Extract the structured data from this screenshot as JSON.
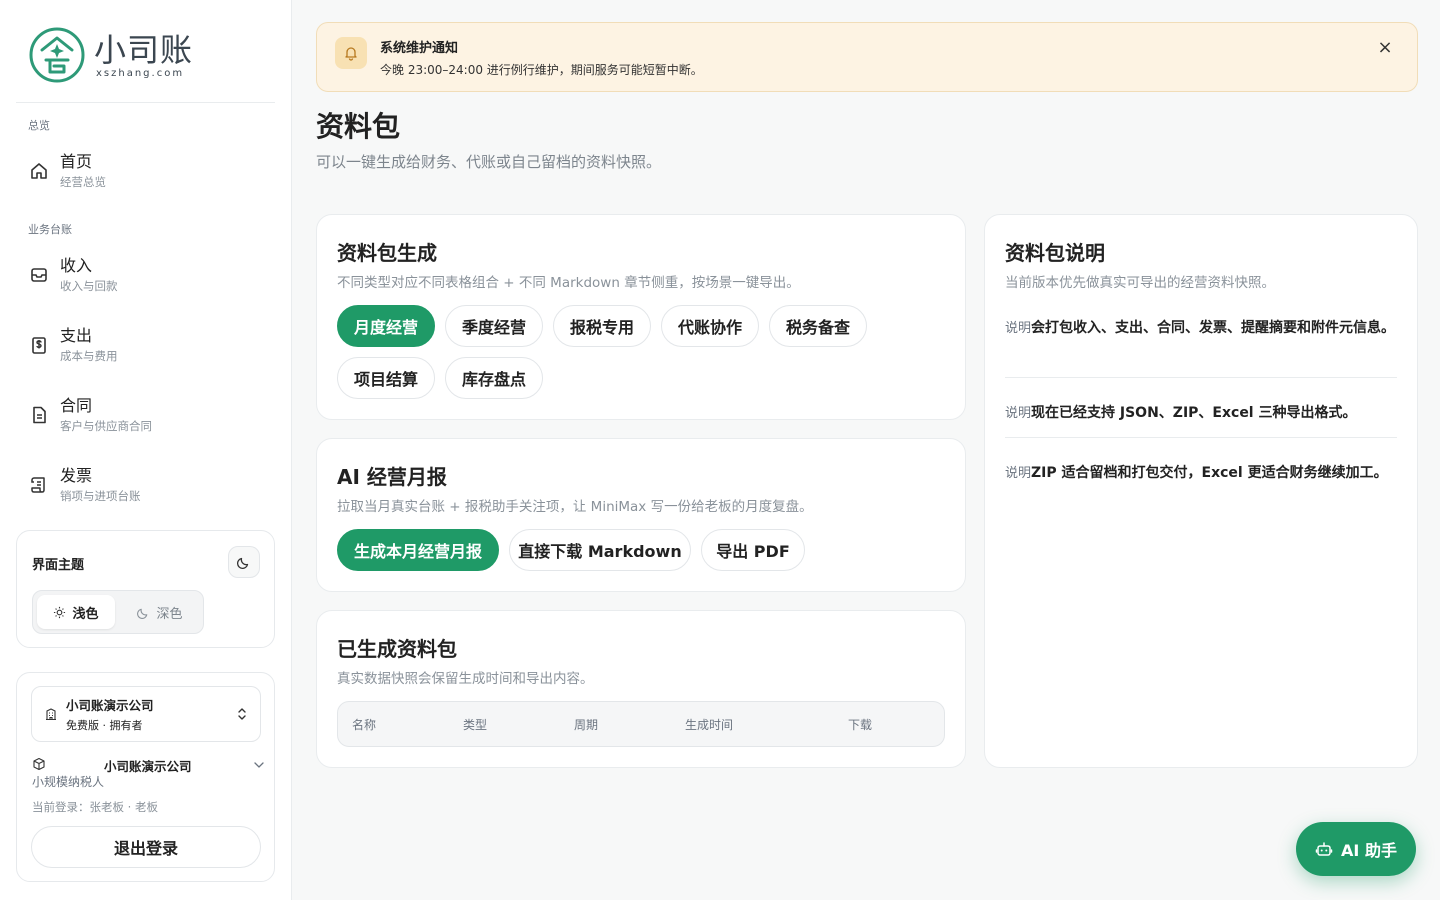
{
  "brand": {
    "name": "小司账",
    "domain": "xszhang.com",
    "color": "#1f9a67"
  },
  "sidebar": {
    "sections": [
      {
        "label": "总览"
      },
      {
        "label": "业务台账"
      }
    ],
    "items": [
      {
        "title": "首页",
        "sub": "经营总览",
        "icon": "home-icon"
      },
      {
        "title": "收入",
        "sub": "收入与回款",
        "icon": "inbox-icon"
      },
      {
        "title": "支出",
        "sub": "成本与费用",
        "icon": "receipt-dollar-icon"
      },
      {
        "title": "合同",
        "sub": "客户与供应商合同",
        "icon": "document-icon"
      },
      {
        "title": "发票",
        "sub": "销项与进项台账",
        "icon": "scroll-icon"
      }
    ],
    "theme": {
      "title": "界面主题",
      "light": "浅色",
      "dark": "深色",
      "selected": "浅色"
    },
    "account": {
      "company_name": "小司账演示公司",
      "plan": "免费版 · 拥有者",
      "company_row_name": "小司账演示公司",
      "taxpayer_type": "小规模纳税人",
      "login_info": "当前登录：张老板 · 老板",
      "logout_label": "退出登录"
    }
  },
  "notice": {
    "title": "系统维护通知",
    "text": "今晚 23:00–24:00 进行例行维护，期间服务可能短暂中断。",
    "close": "×"
  },
  "page": {
    "title": "资料包",
    "subtitle": "可以一键生成给财务、代账或自己留档的资料快照。"
  },
  "generate_card": {
    "title": "资料包生成",
    "subtitle": "不同类型对应不同表格组合 + 不同 Markdown 章节侧重，按场景一键导出。",
    "types": [
      "月度经营",
      "季度经营",
      "报税专用",
      "代账协作",
      "税务备查",
      "项目结算",
      "库存盘点"
    ],
    "selected": "月度经营"
  },
  "ai_report_card": {
    "title": "AI 经营月报",
    "subtitle": "拉取当月真实台账 + 报税助手关注项，让 MiniMax 写一份给老板的月度复盘。",
    "actions": [
      "生成本月经营月报",
      "直接下载 Markdown",
      "导出 PDF"
    ]
  },
  "history_card": {
    "title": "已生成资料包",
    "subtitle": "真实数据快照会保留生成时间和导出内容。",
    "columns": [
      "名称",
      "类型",
      "周期",
      "生成时间",
      "下载"
    ]
  },
  "info_card": {
    "title": "资料包说明",
    "subtitle": "当前版本优先做真实可导出的经营资料快照。",
    "notes": [
      {
        "tag": "说明",
        "text": "会打包收入、支出、合同、发票、提醒摘要和附件元信息。"
      },
      {
        "tag": "说明",
        "text": "现在已经支持 JSON、ZIP、Excel 三种导出格式。"
      },
      {
        "tag": "说明",
        "text": "ZIP 适合留档和打包交付，Excel 更适合财务继续加工。"
      }
    ]
  },
  "ai_assistant": {
    "label": "AI 助手"
  }
}
